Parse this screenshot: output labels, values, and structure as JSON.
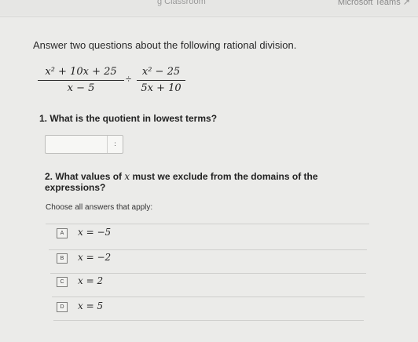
{
  "header": {
    "left_faint": "g Classroom",
    "teams_label": "Microsoft Teams",
    "external_icon": "external-link-icon"
  },
  "question": {
    "prompt": "Answer two questions about the following rational division.",
    "fraction1": {
      "numerator": "x² + 10x + 25",
      "denominator": "x − 5"
    },
    "operator": "÷",
    "fraction2": {
      "numerator": "x² − 25",
      "denominator": "5x + 10"
    }
  },
  "part1": {
    "title": "1. What is the quotient in lowest terms?",
    "answer_value": "",
    "fraction_button_icon": "fraction-icon"
  },
  "part2": {
    "title_before": "2. What values of",
    "title_var": "x",
    "title_after": "must we exclude from the domains of the expressions?",
    "instruction": "Choose all answers that apply:",
    "choices": [
      {
        "letter": "A",
        "expr": "x = −5"
      },
      {
        "letter": "B",
        "expr": "x = −2"
      },
      {
        "letter": "C",
        "expr": "x = 2"
      },
      {
        "letter": "D",
        "expr": "x = 5"
      }
    ]
  }
}
